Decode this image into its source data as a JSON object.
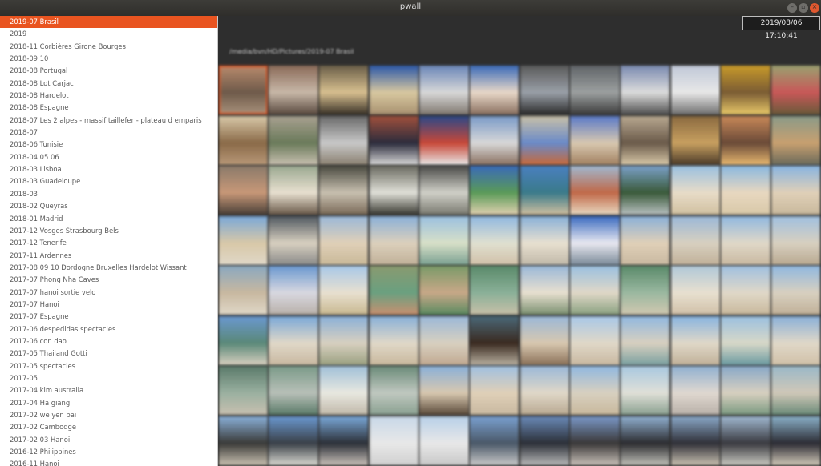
{
  "window": {
    "title": "pwall"
  },
  "clock": "2019/08/06 17:10:41",
  "path": "/media/bvn/HD/Pictures/2019-07 Brasil",
  "selected_index": 0,
  "colors": {
    "accent": "#e95420",
    "window_bg": "#2e2e2e",
    "titlebar": "#3a3935",
    "sidebar_bg": "#ffffff"
  },
  "sidebar": {
    "items": [
      {
        "label": "2019-07 Brasil"
      },
      {
        "label": "2019"
      },
      {
        "label": "2018-11 Corbières Girone Bourges"
      },
      {
        "label": "2018-09 10"
      },
      {
        "label": "2018-08 Portugal"
      },
      {
        "label": "2018-08 Lot Carjac"
      },
      {
        "label": "2018-08 Hardelot"
      },
      {
        "label": "2018-08 Espagne"
      },
      {
        "label": "2018-07 Les 2 alpes - massif taillefer - plateau d emparis"
      },
      {
        "label": "2018-07"
      },
      {
        "label": "2018-06 Tunisie"
      },
      {
        "label": "2018-04 05 06"
      },
      {
        "label": "2018-03 Lisboa"
      },
      {
        "label": "2018-03 Guadeloupe"
      },
      {
        "label": "2018-03"
      },
      {
        "label": "2018-02 Queyras"
      },
      {
        "label": "2018-01 Madrid"
      },
      {
        "label": "2017-12 Vosges Strasbourg Bels"
      },
      {
        "label": "2017-12 Tenerife"
      },
      {
        "label": "2017-11 Ardennes"
      },
      {
        "label": "2017-08 09 10 Dordogne Bruxelles Hardelot Wissant"
      },
      {
        "label": "2017-07 Phong Nha Caves"
      },
      {
        "label": "2017-07 hanoi sortie velo"
      },
      {
        "label": "2017-07 Hanoi"
      },
      {
        "label": "2017-07 Espagne"
      },
      {
        "label": "2017-06 despedidas spectacles"
      },
      {
        "label": "2017-06 con dao"
      },
      {
        "label": "2017-05 Thailand Gotti"
      },
      {
        "label": "2017-05 spectacles"
      },
      {
        "label": "2017-05"
      },
      {
        "label": "2017-04 kim australia"
      },
      {
        "label": "2017-04 Ha giang"
      },
      {
        "label": "2017-02 we yen bai"
      },
      {
        "label": "2017-02 Cambodge"
      },
      {
        "label": "2017-02 03 Hanoi"
      },
      {
        "label": "2016-12 Philippines"
      },
      {
        "label": "2016-11 Hanoi"
      }
    ]
  },
  "thumbnails": {
    "columns": 12,
    "selected": 0,
    "palettes": [
      [
        "#b88a6c",
        "#6e5a4a",
        "#a9927b"
      ],
      [
        "#8a6a58",
        "#c8b8a8",
        "#5a4a40"
      ],
      [
        "#6a5e48",
        "#d8c090",
        "#3a3228"
      ],
      [
        "#2c58a8",
        "#d8c8a0",
        "#a89070"
      ],
      [
        "#6a86b8",
        "#d8d8d8",
        "#807870"
      ],
      [
        "#3a6ab8",
        "#e8d8c8",
        "#8a7060"
      ],
      [
        "#5a5a5a",
        "#9aa0a8",
        "#2c2c2c"
      ],
      [
        "#606468",
        "#9ca0a0",
        "#3c3c3c"
      ],
      [
        "#7a8ab0",
        "#dcdcdc",
        "#505050"
      ],
      [
        "#c0c8d8",
        "#e8e8e8",
        "#707070"
      ],
      [
        "#c89a2a",
        "#7a5c34",
        "#e8c868"
      ],
      [
        "#9aa070",
        "#c85858",
        "#6a5a3a"
      ],
      [
        "#d8c8a8",
        "#8a6a48",
        "#b89878"
      ],
      [
        "#a8a090",
        "#6a7a5a",
        "#c8c0b0"
      ],
      [
        "#6a6a6a",
        "#c8c8c8",
        "#8a8070"
      ],
      [
        "#a0503c",
        "#2c2c3c",
        "#d8d8d8"
      ],
      [
        "#2c4888",
        "#c84838",
        "#e8e8e8"
      ],
      [
        "#7a9ac8",
        "#d8d8d8",
        "#8a7060"
      ],
      [
        "#c8c0a8",
        "#6a8ac8",
        "#c86838"
      ],
      [
        "#5a7ac8",
        "#d8c8b0",
        "#a08060"
      ],
      [
        "#b8a890",
        "#6a5a4a",
        "#d8c8a8"
      ],
      [
        "#8a6a40",
        "#c8a060",
        "#4a3a28"
      ],
      [
        "#c88858",
        "#6a4a38",
        "#e8b870"
      ],
      [
        "#8a9a88",
        "#c8a070",
        "#6a6a5a"
      ],
      [
        "#8a7a6a",
        "#c89878",
        "#4a4038"
      ],
      [
        "#9aa890",
        "#e8e0d0",
        "#6a5a4a"
      ],
      [
        "#4a4a40",
        "#c8c0b0",
        "#7a6a58"
      ],
      [
        "#6a6a60",
        "#e0e0d8",
        "#3a3a34"
      ],
      [
        "#4a4a48",
        "#d0d0c8",
        "#7a7a70"
      ],
      [
        "#3a6ab8",
        "#5a9a58",
        "#e0d0b0"
      ],
      [
        "#4a80c0",
        "#3a7a8a",
        "#d0c0a0"
      ],
      [
        "#a0b8d0",
        "#c06848",
        "#e8d8c0"
      ],
      [
        "#7aa0c8",
        "#3a5a3a",
        "#b8c0c0"
      ],
      [
        "#9ac0e0",
        "#e8dcc8",
        "#d0c0a0"
      ],
      [
        "#8ab8e0",
        "#e8d8c0",
        "#d8c8a8"
      ],
      [
        "#88b4e0",
        "#e0d0b8",
        "#c8b89c"
      ],
      [
        "#7aa8d8",
        "#d8c8a8",
        "#e0d8c8"
      ],
      [
        "#505860",
        "#d8d0c0",
        "#8a8a88"
      ],
      [
        "#9ab8d8",
        "#e0d0b8",
        "#c8b898"
      ],
      [
        "#8ab0d8",
        "#dcd0bc",
        "#c0b098"
      ],
      [
        "#9ac0e0",
        "#d8e0c8",
        "#7aa090"
      ],
      [
        "#90b8e0",
        "#e0e0d0",
        "#d0c0a8"
      ],
      [
        "#88b0d8",
        "#e8e0d0",
        "#c0b8a8"
      ],
      [
        "#3a6ac0",
        "#e8e8f0",
        "#7a8a98"
      ],
      [
        "#8ab0d8",
        "#e0d0b8",
        "#c8b8a0"
      ],
      [
        "#9ab8d8",
        "#d8d0c0",
        "#c0b098"
      ],
      [
        "#90b8e0",
        "#e0d8c8",
        "#c8b8a0"
      ],
      [
        "#a0c0e0",
        "#d8d0c0",
        "#b8a890"
      ],
      [
        "#8aa8c0",
        "#c8b8a0",
        "#e0d8c8"
      ],
      [
        "#6a98d0",
        "#d8d8e0",
        "#b8b0a8"
      ],
      [
        "#a8c8e8",
        "#e8e0d0",
        "#c8b890"
      ],
      [
        "#8a9a70",
        "#6aa080",
        "#c89070"
      ],
      [
        "#7a9a68",
        "#c8a888",
        "#5a8a60"
      ],
      [
        "#5a8a6a",
        "#8ab098",
        "#c8c0a8"
      ],
      [
        "#9ab8d8",
        "#e8e0d0",
        "#7a9070"
      ],
      [
        "#9ac0e0",
        "#e0d8c8",
        "#8aa080"
      ],
      [
        "#5a8a6a",
        "#9ab8a0",
        "#d0c8b0"
      ],
      [
        "#b0c8d8",
        "#e8e0d0",
        "#d0c0a8"
      ],
      [
        "#a0c0e0",
        "#e0d8c8",
        "#c8b89c"
      ],
      [
        "#90b8e0",
        "#d8d0c0",
        "#c0b098"
      ],
      [
        "#6a98d0",
        "#5a8878",
        "#d8d0c0"
      ],
      [
        "#7aa8d8",
        "#e0d8c8",
        "#c8b8a0"
      ],
      [
        "#8ab0d8",
        "#d8d0c0",
        "#9aa080"
      ],
      [
        "#88b0d8",
        "#e0d8c8",
        "#c8b89c"
      ],
      [
        "#9ab8d8",
        "#d8d0c0",
        "#c0a890"
      ],
      [
        "#4a6878",
        "#3a2a20",
        "#b8b0a0"
      ],
      [
        "#9ab8d8",
        "#d8c8b0",
        "#8a7058"
      ],
      [
        "#a8c8e8",
        "#e0d8c8",
        "#c8b8a0"
      ],
      [
        "#90b8e0",
        "#d8d0c0",
        "#7aa0a0"
      ],
      [
        "#88b4e0",
        "#e0d8c8",
        "#c0b098"
      ],
      [
        "#9ac0e0",
        "#d8d8c8",
        "#6a9aa0"
      ],
      [
        "#8ab0d8",
        "#e0d8c8",
        "#d0c0a8"
      ],
      [
        "#5a7a6a",
        "#9ab0a0",
        "#c8c0b0"
      ],
      [
        "#7a9a88",
        "#b8c0b8",
        "#5a7a68"
      ],
      [
        "#a0c0d8",
        "#e8e8e0",
        "#c0b8a8"
      ],
      [
        "#6a8a78",
        "#c0c8c0",
        "#8aa090"
      ],
      [
        "#8ab0d8",
        "#d8c8b0",
        "#5a4a3a"
      ],
      [
        "#a0c0e0",
        "#e0d0b8",
        "#c8b8a0"
      ],
      [
        "#9ab8d8",
        "#e0d8c8",
        "#b8a890"
      ],
      [
        "#90b8e0",
        "#d8d0c0",
        "#c8b89c"
      ],
      [
        "#a8c8e0",
        "#e0e0d8",
        "#8aa090"
      ],
      [
        "#90b0d0",
        "#e0d8d0",
        "#b8b0a8"
      ],
      [
        "#88a8c8",
        "#d8d0c0",
        "#7a9880"
      ],
      [
        "#9ab8c8",
        "#d0c8b8",
        "#6a8a78"
      ],
      [
        "#8ab0d8",
        "#3a3a38",
        "#c8c0b0"
      ],
      [
        "#6a98d0",
        "#3a4048",
        "#d8d8d0"
      ],
      [
        "#7aa8d8",
        "#2c3038",
        "#c8c0b8"
      ],
      [
        "#c8d8e8",
        "#e8e8e8",
        "#d0d0d0"
      ],
      [
        "#b8d0e8",
        "#e8e8e8",
        "#c8c8c8"
      ],
      [
        "#7aa0d0",
        "#4a5868",
        "#c8c8c8"
      ],
      [
        "#6a8ab8",
        "#2c3038",
        "#b8b8b8"
      ],
      [
        "#7a98c8",
        "#3a3838",
        "#c8c0b8"
      ],
      [
        "#90b0d0",
        "#2c2c30",
        "#c0c0b8"
      ],
      [
        "#8aa8c8",
        "#303038",
        "#c8c0b0"
      ],
      [
        "#a0b8d0",
        "#3a3a40",
        "#c8c8c0"
      ],
      [
        "#8ab0c8",
        "#2c2c34",
        "#d0c8b8"
      ]
    ]
  }
}
